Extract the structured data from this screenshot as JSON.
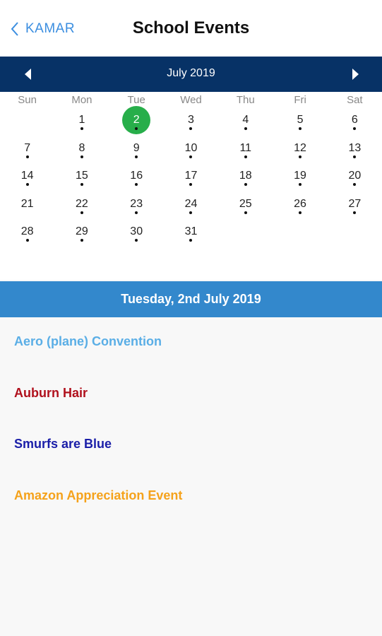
{
  "header": {
    "back_label": "KAMAR",
    "title": "School Events"
  },
  "calendar": {
    "month_label": "July 2019",
    "weekdays": [
      "Sun",
      "Mon",
      "Tue",
      "Wed",
      "Thu",
      "Fri",
      "Sat"
    ],
    "start_offset": 1,
    "days": [
      {
        "d": "1",
        "dot": true
      },
      {
        "d": "2",
        "dot": true,
        "selected": true
      },
      {
        "d": "3",
        "dot": true
      },
      {
        "d": "4",
        "dot": true
      },
      {
        "d": "5",
        "dot": true
      },
      {
        "d": "6",
        "dot": true
      },
      {
        "d": "7",
        "dot": true
      },
      {
        "d": "8",
        "dot": true
      },
      {
        "d": "9",
        "dot": true
      },
      {
        "d": "10",
        "dot": true
      },
      {
        "d": "11",
        "dot": true
      },
      {
        "d": "12",
        "dot": true
      },
      {
        "d": "13",
        "dot": true
      },
      {
        "d": "14",
        "dot": true
      },
      {
        "d": "15",
        "dot": true
      },
      {
        "d": "16",
        "dot": true
      },
      {
        "d": "17",
        "dot": true
      },
      {
        "d": "18",
        "dot": true
      },
      {
        "d": "19",
        "dot": true
      },
      {
        "d": "20",
        "dot": true
      },
      {
        "d": "21",
        "dot": false
      },
      {
        "d": "22",
        "dot": true
      },
      {
        "d": "23",
        "dot": true
      },
      {
        "d": "24",
        "dot": true
      },
      {
        "d": "25",
        "dot": true
      },
      {
        "d": "26",
        "dot": true
      },
      {
        "d": "27",
        "dot": true
      },
      {
        "d": "28",
        "dot": true
      },
      {
        "d": "29",
        "dot": true
      },
      {
        "d": "30",
        "dot": true
      },
      {
        "d": "31",
        "dot": true
      }
    ],
    "selected_color": "#27ae4a"
  },
  "selected_date_label": "Tuesday, 2nd July 2019",
  "events": [
    {
      "title": "Aero (plane) Convention",
      "color": "#5aaee6"
    },
    {
      "title": "Auburn Hair",
      "color": "#b0101c"
    },
    {
      "title": "Smurfs are Blue",
      "color": "#1a1ea8"
    },
    {
      "title": "Amazon Appreciation Event",
      "color": "#f5a21b"
    }
  ],
  "colors": {
    "month_bar": "#073266",
    "date_bar": "#3388cc",
    "accent": "#3b8ee0"
  }
}
